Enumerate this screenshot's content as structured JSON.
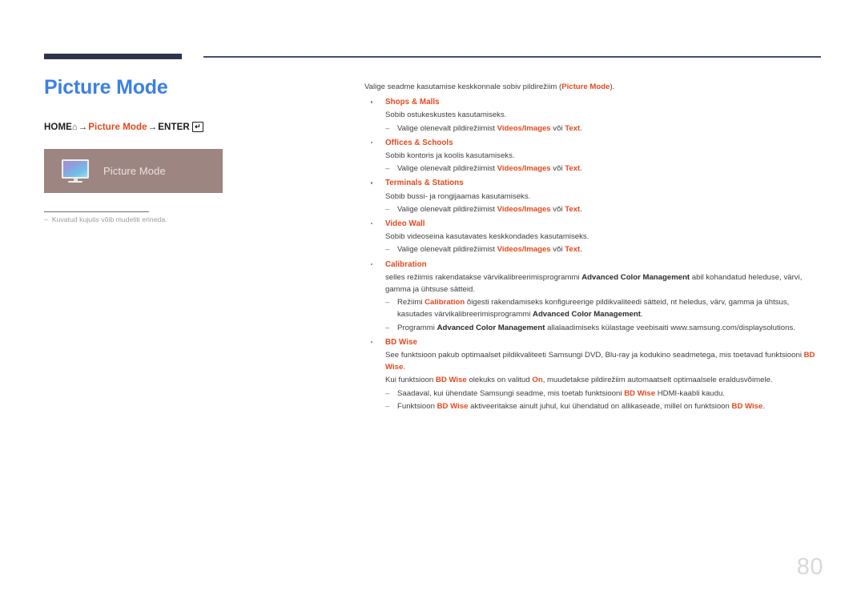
{
  "header": {
    "rule_color_thick": "#2e3450",
    "rule_color_thin": "#474e6b"
  },
  "left": {
    "title": "Picture Mode",
    "title_color": "#3c7fe8",
    "nav": {
      "home_label": "HOME",
      "home_icon": "home-icon",
      "arrow": "→",
      "menu_label": "Picture Mode",
      "enter_label": "ENTER",
      "enter_icon": "enter-key-icon"
    },
    "preview": {
      "icon": "monitor-icon",
      "label": "Picture Mode",
      "background_color": "#9d8682"
    },
    "note": {
      "dash": "‒",
      "text": "Kuvatud kujutis võib mudeliti erineda."
    }
  },
  "right": {
    "intro_prefix": "Valige seadme kasutamise keskkonnale sobiv pildirežiim (",
    "intro_accent": "Picture Mode",
    "intro_suffix": ").",
    "items": [
      {
        "title": "Shops & Malls",
        "body": "Sobib ostukeskustes kasutamiseks.",
        "sub_prefix": "Valige olenevalt pildirežiimist ",
        "sub_accent1": "Videos/Images",
        "sub_mid": " või ",
        "sub_accent2": "Text",
        "sub_suffix": "."
      },
      {
        "title": "Offices & Schools",
        "body": "Sobib kontoris ja koolis kasutamiseks.",
        "sub_prefix": "Valige olenevalt pildirežiimist ",
        "sub_accent1": "Videos/Images",
        "sub_mid": " või ",
        "sub_accent2": "Text",
        "sub_suffix": "."
      },
      {
        "title": "Terminals & Stations",
        "body": "Sobib bussi- ja rongijaamas kasutamiseks.",
        "sub_prefix": "Valige olenevalt pildirežiimist ",
        "sub_accent1": "Videos/Images",
        "sub_mid": " või ",
        "sub_accent2": "Text",
        "sub_suffix": "."
      },
      {
        "title": "Video Wall",
        "body": "Sobib videoseina kasutavates keskkondades kasutamiseks.",
        "sub_prefix": "Valige olenevalt pildirežiimist ",
        "sub_accent1": "Videos/Images",
        "sub_mid": " või ",
        "sub_accent2": "Text",
        "sub_suffix": "."
      }
    ],
    "calibration": {
      "title": "Calibration",
      "body_prefix": "selles režiimis rakendatakse värvikalibreerimisprogrammi ",
      "body_bold": "Advanced Color Management",
      "body_suffix": " abil kohandatud heleduse, värvi, gamma ja ühtsuse sätteid.",
      "sub1_prefix": "Režiimi ",
      "sub1_accent": "Calibration",
      "sub1_mid": " õigesti rakendamiseks konfigureerige pildikvaliteedi sätteid, nt heledus, värv, gamma ja ühtsus, kasutades värvikalibreerimisprogrammi ",
      "sub1_bold": "Advanced Color Management",
      "sub1_suffix": ".",
      "sub2_prefix": "Programmi ",
      "sub2_bold": "Advanced Color Management",
      "sub2_suffix": " allalaadimiseks külastage veebisaiti www.samsung.com/displaysolutions."
    },
    "bdwise": {
      "title": "BD Wise",
      "para1_prefix": "See funktsioon pakub optimaalset pildikvaliteeti Samsungi DVD, Blu-ray ja kodukino seadmetega, mis toetavad funktsiooni ",
      "para1_accent": "BD Wise",
      "para1_suffix": ".",
      "para2_prefix": "Kui funktsioon ",
      "para2_accent1": "BD Wise",
      "para2_mid": " olekuks on valitud ",
      "para2_accent2": "On",
      "para2_suffix": ", muudetakse pildirežiim automaatselt optimaalsele eraldusvõimele.",
      "sub1_prefix": "Saadaval, kui ühendate Samsungi seadme, mis toetab funktsiooni ",
      "sub1_accent": "BD Wise",
      "sub1_suffix": " HDMI-kaabli kaudu.",
      "sub2_prefix": "Funktsioon ",
      "sub2_accent1": "BD Wise",
      "sub2_mid": " aktiveeritakse ainult juhul, kui ühendatud on allikaseade, millel on funktsioon ",
      "sub2_accent2": "BD Wise",
      "sub2_suffix": "."
    },
    "dash": "‒"
  },
  "footer": {
    "page_number": "80"
  }
}
